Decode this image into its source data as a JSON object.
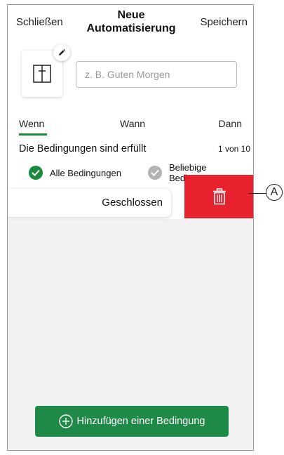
{
  "header": {
    "close_label": "Schließen",
    "title_line1": "Neue",
    "title_line2": "Automatisierung",
    "save_label": "Speichern"
  },
  "name_field": {
    "placeholder": "z. B. Guten Morgen",
    "value": ""
  },
  "tabs": [
    {
      "label": "Wenn",
      "active": true
    },
    {
      "label": "Wann",
      "active": false
    },
    {
      "label": "Dann",
      "active": false
    }
  ],
  "conditions": {
    "title": "Die Bedingungen sind erfüllt",
    "count": "1 von 10",
    "options": [
      {
        "label": "Alle Bedingungen",
        "selected": true
      },
      {
        "label": "Beliebige Bedingung",
        "selected": false
      }
    ]
  },
  "condition_card": {
    "label": "Geschlossen"
  },
  "add_button": {
    "label": "Hinzufügen einer Bedingung"
  },
  "callout": {
    "letter": "A"
  },
  "colors": {
    "accent_green": "#1a8a3c",
    "delete_red": "#e8212f",
    "button_green": "#1f8a47"
  },
  "icons": {
    "tile": "layout-icon",
    "edit": "pencil-icon",
    "delete": "trash-icon",
    "add": "plus-circle-icon"
  }
}
